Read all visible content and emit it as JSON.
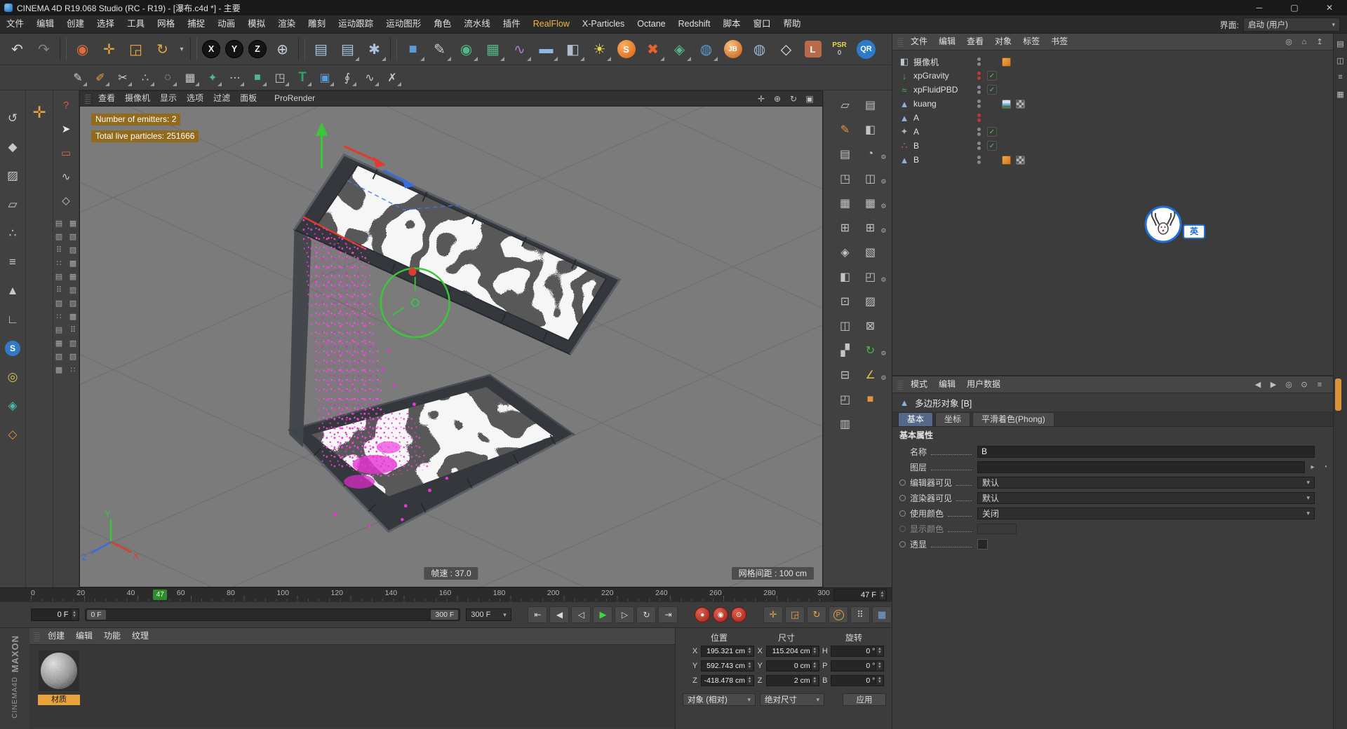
{
  "titlebar": {
    "title": "CINEMA 4D R19.068 Studio (RC - R19) - [瀑布.c4d *] - 主要",
    "minimize": "─",
    "maximize": "▢",
    "close": "✕"
  },
  "menubar": {
    "items": [
      {
        "label": "文件"
      },
      {
        "label": "编辑"
      },
      {
        "label": "创建"
      },
      {
        "label": "选择"
      },
      {
        "label": "工具"
      },
      {
        "label": "网格"
      },
      {
        "label": "捕捉"
      },
      {
        "label": "动画"
      },
      {
        "label": "模拟"
      },
      {
        "label": "渲染"
      },
      {
        "label": "雕刻"
      },
      {
        "label": "运动跟踪"
      },
      {
        "label": "运动图形"
      },
      {
        "label": "角色"
      },
      {
        "label": "流水线"
      },
      {
        "label": "插件"
      },
      {
        "label": "RealFlow",
        "cls": "hl"
      },
      {
        "label": "X-Particles"
      },
      {
        "label": "Octane"
      },
      {
        "label": "Redshift"
      },
      {
        "label": "脚本"
      },
      {
        "label": "窗口"
      },
      {
        "label": "帮助"
      }
    ],
    "interface_label": "界面:",
    "interface_value": "启动 (用户)",
    "caret": "▾"
  },
  "toolbar_main": {
    "icons": [
      {
        "name": "undo-icon",
        "g": "↶",
        "c": "#d8d8d8"
      },
      {
        "name": "redo-icon",
        "g": "↷",
        "c": "#858585"
      },
      {
        "name": "toolbar-separator",
        "cls": "sep"
      },
      {
        "name": "live-selection-icon",
        "g": "◉",
        "c": "#e06a3a"
      },
      {
        "name": "move-tool-icon",
        "g": "✛",
        "c": "#e8a33d"
      },
      {
        "name": "scale-tool-icon",
        "g": "◲",
        "c": "#e8a33d"
      },
      {
        "name": "rotate-tool-icon",
        "g": "↻",
        "c": "#e8a33d"
      },
      {
        "name": "last-tool-icon",
        "g": "▾",
        "c": "#b8b8b8",
        "cls": "narrow"
      },
      {
        "name": "toolbar-separator",
        "cls": "sep"
      },
      {
        "name": "x-axis-lock-icon",
        "g": "X",
        "cls": "axis"
      },
      {
        "name": "y-axis-lock-icon",
        "g": "Y",
        "cls": "axis"
      },
      {
        "name": "z-axis-lock-icon",
        "g": "Z",
        "cls": "axis"
      },
      {
        "name": "coordinate-system-icon",
        "g": "⊕",
        "c": "#c8d0d8"
      },
      {
        "name": "toolbar-separator",
        "cls": "sep"
      },
      {
        "name": "render-view-icon",
        "g": "▤",
        "c": "#a8c4dc"
      },
      {
        "name": "render-picture-viewer-icon",
        "g": "▤",
        "c": "#a8c4dc",
        "cls": "dd"
      },
      {
        "name": "render-settings-icon",
        "g": "✱",
        "c": "#a8c4dc",
        "cls": "dd"
      },
      {
        "name": "toolbar-separator",
        "cls": "sep"
      },
      {
        "name": "add-cube-icon",
        "g": "■",
        "c": "#5b9bd5",
        "cls": "dd"
      },
      {
        "name": "spline-pen-icon",
        "g": "✎",
        "c": "#d0d0d0",
        "cls": "dd"
      },
      {
        "name": "subdivision-surface-icon",
        "g": "◉",
        "c": "#52b788",
        "cls": "dd"
      },
      {
        "name": "generator-icon",
        "g": "▦",
        "c": "#52b788",
        "cls": "dd"
      },
      {
        "name": "deformer-icon",
        "g": "∿",
        "c": "#b07ad0",
        "cls": "dd"
      },
      {
        "name": "environment-icon",
        "g": "▬",
        "c": "#8fb8e8",
        "cls": "dd"
      },
      {
        "name": "camera-icon",
        "g": "◧",
        "c": "#b0bcc8",
        "cls": "dd"
      },
      {
        "name": "light-icon",
        "g": "☀",
        "c": "#e8d44d",
        "cls": "dd"
      },
      {
        "name": "realflow-icon",
        "g": "S",
        "cls": "rf"
      },
      {
        "name": "xparticles-icon",
        "g": "✖",
        "c": "#e8622d",
        "cls": "dd"
      },
      {
        "name": "mograph-icon",
        "g": "◈",
        "c": "#52b788",
        "cls": "dd"
      },
      {
        "name": "dynamics-icon",
        "g": "◍",
        "c": "#5b9bd5",
        "cls": "dd"
      },
      {
        "name": "jb-plugin-icon",
        "g": "JB",
        "cls": "jb"
      },
      {
        "name": "globe-plugin-icon",
        "g": "◍",
        "c": "#9ab8d8"
      },
      {
        "name": "octane-icon",
        "g": "◇",
        "c": "#dce6f0"
      },
      {
        "name": "l-plugin-icon",
        "g": "L",
        "cls": "lb"
      },
      {
        "name": "psr-icon",
        "g": "PSR",
        "sub": "0",
        "cls": "psr"
      },
      {
        "name": "qr-icon",
        "g": "QR",
        "cls": "qr"
      }
    ]
  },
  "toolbar_model": {
    "icons": [
      {
        "name": "poly-pen-icon",
        "g": "✎",
        "c": "#d0d0d0"
      },
      {
        "name": "sculpt-brush-icon",
        "g": "✐",
        "c": "#e8a33d"
      },
      {
        "name": "knife-icon",
        "g": "✂",
        "c": "#d0d0d0"
      },
      {
        "name": "points-icon",
        "g": "∴",
        "c": "#c8c8c8"
      },
      {
        "name": "cluster-icon",
        "g": "◌",
        "c": "#c8c8c8"
      },
      {
        "name": "array-icon",
        "g": "▦",
        "c": "#c8c8c8"
      },
      {
        "name": "magic-icon",
        "g": "✦",
        "c": "#52b788"
      },
      {
        "name": "dots-icon",
        "g": "⋯",
        "c": "#c8c8c8"
      },
      {
        "name": "cube-tool-icon",
        "g": "■",
        "c": "#52b788"
      },
      {
        "name": "corner-tool-icon",
        "g": "◳",
        "c": "#c8c8c8"
      },
      {
        "name": "text-tool-icon",
        "g": "T",
        "cls": "txt"
      },
      {
        "name": "instance-icon",
        "g": "▣",
        "c": "#5b9bd5"
      },
      {
        "name": "spiral-icon",
        "g": "∮",
        "c": "#c8c8c8"
      },
      {
        "name": "sweep-icon",
        "g": "∿",
        "c": "#c8c8c8"
      },
      {
        "name": "fx-icon",
        "g": "✗",
        "c": "#c8c8c8"
      }
    ]
  },
  "mode_palette": {
    "icons": [
      {
        "name": "make-editable-icon",
        "g": "↺",
        "c": "#c8c8c8"
      },
      {
        "name": "model-mode-icon",
        "g": "◆",
        "c": "#c8c8c8"
      },
      {
        "name": "texture-mode-icon",
        "g": "▨",
        "c": "#c8c8c8"
      },
      {
        "name": "workplane-mode-icon",
        "g": "▱",
        "c": "#c8c8c8"
      },
      {
        "name": "points-mode-icon",
        "g": "∴",
        "c": "#c8c8c8"
      },
      {
        "name": "edges-mode-icon",
        "g": "≡",
        "c": "#c8c8c8"
      },
      {
        "name": "polygons-mode-icon",
        "g": "▲",
        "c": "#c8c8c8"
      },
      {
        "name": "axis-mode-icon",
        "g": "∟",
        "c": "#c8c8c8"
      },
      {
        "name": "snap-mode-icon",
        "g": "S",
        "cls": "snapS"
      },
      {
        "name": "solo-mode-icon",
        "g": "◎",
        "c": "#d8c04a"
      },
      {
        "name": "snapping-icon",
        "g": "◈",
        "c": "#4ab8a8"
      },
      {
        "name": "quantize-icon",
        "g": "◇",
        "c": "#d8923a"
      }
    ]
  },
  "tool_palette": {
    "move_glyph": "✛",
    "top_icons": [
      {
        "name": "commander-icon",
        "g": "?",
        "c": "#e05545"
      },
      {
        "name": "selection-arrow-icon",
        "g": "➤",
        "c": "#e8e8e8"
      },
      {
        "name": "rectangle-select-icon",
        "g": "▭",
        "c": "#e06a50"
      },
      {
        "name": "lasso-select-icon",
        "g": "∿",
        "c": "#c8c8c8"
      },
      {
        "name": "polygon-select-icon",
        "g": "◇",
        "c": "#c8c8c8"
      }
    ],
    "grid_icons": [
      {
        "g": "▤"
      },
      {
        "g": "▦"
      },
      {
        "g": "▥"
      },
      {
        "g": "▧"
      },
      {
        "g": "⠿"
      },
      {
        "g": "▨"
      },
      {
        "g": "∷"
      },
      {
        "g": "▩"
      },
      {
        "g": "▤"
      },
      {
        "g": "▦"
      },
      {
        "g": "⠿"
      },
      {
        "g": "▥"
      },
      {
        "g": "▧"
      },
      {
        "g": "▨"
      },
      {
        "g": "∷"
      },
      {
        "g": "▩"
      },
      {
        "g": "▤"
      },
      {
        "g": "⠿"
      },
      {
        "g": "▦"
      },
      {
        "g": "▥"
      },
      {
        "g": "▨"
      },
      {
        "g": "▧"
      },
      {
        "g": "▩"
      },
      {
        "g": "∷"
      }
    ]
  },
  "viewport": {
    "menus": [
      {
        "label": "查看"
      },
      {
        "label": "摄像机"
      },
      {
        "label": "显示"
      },
      {
        "label": "选项"
      },
      {
        "label": "过滤"
      },
      {
        "label": "面板"
      }
    ],
    "prorender": "ProRender",
    "nav_icons": [
      {
        "name": "pan-view-icon",
        "g": "✛"
      },
      {
        "name": "zoom-view-icon",
        "g": "⊕"
      },
      {
        "name": "rotate-view-icon",
        "g": "↻"
      },
      {
        "name": "toggle-view-icon",
        "g": "▣"
      }
    ],
    "hud1": "Number of emitters: 2",
    "hud2": "Total live particles: 251666",
    "framerate": "帧速 : 37.0",
    "grid_spacing": "网格间距 : 100 cm",
    "axis": {
      "x": "X",
      "y": "Y",
      "z": "Z"
    }
  },
  "right_dock": {
    "col_a": [
      {
        "name": "dock-plane-icon",
        "g": "▱",
        "c": "#c4c4c4"
      },
      {
        "name": "dock-pen-icon",
        "g": "✎",
        "c": "#e8923d"
      },
      {
        "name": "dock-layout-icon",
        "g": "▤",
        "c": "#c4c4c4"
      },
      {
        "name": "dock-corner-icon",
        "g": "◳",
        "c": "#c4c4c4"
      },
      {
        "name": "dock-grid-icon",
        "g": "▦",
        "c": "#c4c4c4"
      },
      {
        "name": "dock-plus-icon",
        "g": "⊞",
        "c": "#c4c4c4"
      },
      {
        "name": "dock-diamond-icon",
        "g": "◈",
        "c": "#c4c4c4"
      },
      {
        "name": "dock-half-icon",
        "g": "◧",
        "c": "#c4c4c4"
      },
      {
        "name": "dock-dot-icon",
        "g": "⊡",
        "c": "#c4c4c4"
      },
      {
        "name": "dock-window-icon",
        "g": "◫",
        "c": "#c4c4c4"
      },
      {
        "name": "dock-slash-icon",
        "g": "▞",
        "c": "#c4c4c4"
      },
      {
        "name": "dock-minus-icon",
        "g": "⊟",
        "c": "#c4c4c4"
      },
      {
        "name": "dock-quad-icon",
        "g": "◰",
        "c": "#c4c4c4"
      },
      {
        "name": "dock-rows-icon",
        "g": "▥",
        "c": "#c4c4c4"
      }
    ],
    "col_b": [
      {
        "name": "dockb-layout-icon",
        "g": "▤",
        "c": "#c4c4c4"
      },
      {
        "name": "dockb-half-icon",
        "g": "◧",
        "c": "#c4c4c4"
      },
      {
        "name": "dockb-clock-icon",
        "g": "◔",
        "c": "#c4c4c4",
        "gear": "⚙"
      },
      {
        "name": "dockb-window-icon",
        "g": "◫",
        "c": "#c4c4c4",
        "gear": "⚙"
      },
      {
        "name": "dockb-grid-icon",
        "g": "▦",
        "c": "#c4c4c4",
        "gear": "⚙"
      },
      {
        "name": "dockb-plus-icon",
        "g": "⊞",
        "c": "#c4c4c4",
        "gear": "⚙"
      },
      {
        "name": "dockb-shade-icon",
        "g": "▧",
        "c": "#c4c4c4"
      },
      {
        "name": "dockb-quad-icon",
        "g": "◰",
        "c": "#c4c4c4",
        "gear": "⚙"
      },
      {
        "name": "dockb-hatch-icon",
        "g": "▨",
        "c": "#c4c4c4"
      },
      {
        "name": "dockb-box-icon",
        "g": "⊠",
        "c": "#c4c4c4"
      },
      {
        "name": "recycle-icon",
        "g": "↻",
        "c": "#4db24d",
        "gear": "⚙"
      },
      {
        "name": "measure-icon",
        "g": "∠",
        "c": "#d8c04a",
        "gear": "⚙"
      },
      {
        "name": "workplane-cube-icon",
        "g": "■",
        "c": "#e8923d"
      }
    ]
  },
  "right_strip": {
    "icons": [
      {
        "name": "strip-layout-icon",
        "g": "▤"
      },
      {
        "name": "strip-window-icon",
        "g": "◫"
      },
      {
        "name": "strip-menu-icon",
        "g": "≡"
      },
      {
        "name": "strip-grid-icon",
        "g": "▦"
      }
    ]
  },
  "object_manager": {
    "menus": [
      {
        "label": "文件"
      },
      {
        "label": "编辑"
      },
      {
        "label": "查看"
      },
      {
        "label": "对象"
      },
      {
        "label": "标签"
      },
      {
        "label": "书签"
      }
    ],
    "menu_icons": [
      {
        "name": "om-search-icon",
        "g": "◎"
      },
      {
        "name": "om-home-icon",
        "g": "⌂"
      },
      {
        "name": "om-up-icon",
        "g": "↥"
      }
    ],
    "items": [
      {
        "label": "摄像机",
        "icon_name": "camera-object-icon",
        "icon_glyph": "◧",
        "icon_color": "#b8c4ce",
        "dots": "gray",
        "tag1": "orange"
      },
      {
        "label": "xpGravity",
        "icon_name": "xpgravity-icon",
        "icon_glyph": "↓",
        "icon_color": "#4db24d",
        "dots": "red",
        "check": "✓"
      },
      {
        "label": "xpFluidPBD",
        "icon_name": "xpfluid-icon",
        "icon_glyph": "≈",
        "icon_color": "#4db24d",
        "dots": "gray",
        "check": "✓"
      },
      {
        "label": "kuang",
        "icon_name": "polygon-object-icon",
        "icon_glyph": "▲",
        "icon_color": "#8fb0d8",
        "dots": "gray",
        "tag1": "image",
        "tag2": "checker"
      },
      {
        "label": "A",
        "icon_name": "polygon-object-icon",
        "icon_glyph": "▲",
        "icon_color": "#8fb0d8",
        "dots": "red"
      },
      {
        "label": "A",
        "icon_name": "emitter-object-icon",
        "icon_glyph": "✦",
        "icon_color": "#a8b4c0",
        "dots": "gray",
        "check": "✓"
      },
      {
        "label": "B",
        "icon_name": "particles-object-icon",
        "icon_glyph": "∴",
        "icon_color": "#e04fd0",
        "dots": "gray",
        "check": "✓"
      },
      {
        "label": "B",
        "icon_name": "polygon-object-icon",
        "icon_glyph": "▲",
        "icon_color": "#8fb0d8",
        "dots": "gray",
        "tag1": "orange",
        "tag2": "checker"
      }
    ]
  },
  "attribute_manager": {
    "menus": [
      {
        "label": "模式"
      },
      {
        "label": "编辑"
      },
      {
        "label": "用户数据"
      }
    ],
    "menu_icons": [
      {
        "name": "am-back-icon",
        "g": "◀"
      },
      {
        "name": "am-forward-icon",
        "g": "▶"
      },
      {
        "name": "am-focus-icon",
        "g": "◎"
      },
      {
        "name": "am-lock-icon",
        "g": "⊙"
      },
      {
        "name": "am-menu-icon",
        "g": "≡"
      }
    ],
    "object_icon": "▲",
    "object_title": "多边形对象 [B]",
    "tabs": [
      {
        "label": "基本",
        "cls": "active"
      },
      {
        "label": "坐标"
      },
      {
        "label": "平滑着色(Phong)"
      }
    ],
    "section": "基本属性",
    "name_label": "名称",
    "name_value": "B",
    "layer_label": "图层",
    "vis_editor_label": "编辑器可见",
    "vis_editor_value": "默认",
    "vis_render_label": "渲染器可见",
    "vis_render_value": "默认",
    "use_color_label": "使用颜色",
    "use_color_value": "关闭",
    "display_color_label": "显示颜色",
    "xray_label": "透显",
    "caret": "▾"
  },
  "timeline": {
    "ticks": [
      "0",
      "20",
      "40",
      "60",
      "80",
      "100",
      "120",
      "140",
      "160",
      "180",
      "200",
      "220",
      "240",
      "260",
      "280",
      "300"
    ],
    "marker_label": "47",
    "marker_left": "15.3%",
    "frame_field": "47 F"
  },
  "transport": {
    "start_field": "0 F",
    "range_start": "0 F",
    "range_end": "300 F",
    "range_dropdown": "300 F",
    "caret": "▾",
    "buttons": [
      {
        "name": "goto-start-button",
        "g": "⇤"
      },
      {
        "name": "previous-key-button",
        "g": "◀"
      },
      {
        "name": "play-backward-button",
        "g": "◁"
      },
      {
        "name": "play-button",
        "g": "▶",
        "cls": "play"
      },
      {
        "name": "next-frame-button",
        "g": "▷"
      },
      {
        "name": "loop-button",
        "g": "↻"
      },
      {
        "name": "goto-end-button",
        "g": "⇥"
      }
    ],
    "records": [
      {
        "name": "record-keyframe-button",
        "g": "●"
      },
      {
        "name": "autokey-button",
        "g": "◉"
      },
      {
        "name": "keyframe-selection-button",
        "g": "⊙"
      }
    ],
    "keys": [
      {
        "name": "position-key-toggle",
        "g": "✛"
      },
      {
        "name": "scale-key-toggle",
        "g": "◲"
      },
      {
        "name": "rotation-key-toggle",
        "g": "↻"
      },
      {
        "name": "parameter-key-toggle",
        "g": "P",
        "cls": "pk"
      },
      {
        "name": "pla-key-toggle",
        "g": "⠿",
        "cls": "gray"
      },
      {
        "name": "timeline-window-button",
        "g": "▦",
        "cls": "blue"
      }
    ]
  },
  "material_manager": {
    "menus": [
      {
        "label": "创建"
      },
      {
        "label": "编辑"
      },
      {
        "label": "功能"
      },
      {
        "label": "纹理"
      }
    ],
    "material_name": "材质"
  },
  "coordinate_manager": {
    "headers": [
      {
        "label": "位置"
      },
      {
        "label": "尺寸"
      },
      {
        "label": "旋转"
      }
    ],
    "rows": [
      {
        "pl": "X",
        "pv": "195.321 cm",
        "sl": "X",
        "sv": "115.204 cm",
        "rl": "H",
        "rv": "0 °"
      },
      {
        "pl": "Y",
        "pv": "592.743 cm",
        "sl": "Y",
        "sv": "0 cm",
        "rl": "P",
        "rv": "0 °"
      },
      {
        "pl": "Z",
        "pv": "-418.478 cm",
        "sl": "Z",
        "sv": "2 cm",
        "rl": "B",
        "rv": "0 °"
      }
    ],
    "mode_dropdown": "对象 (相对)",
    "size_dropdown": "绝对尺寸",
    "apply": "应用",
    "caret": "▾"
  },
  "branding": {
    "maxon": "MAXON",
    "cinema": "CINEMA4D"
  },
  "watermark": {
    "badge": "英"
  }
}
